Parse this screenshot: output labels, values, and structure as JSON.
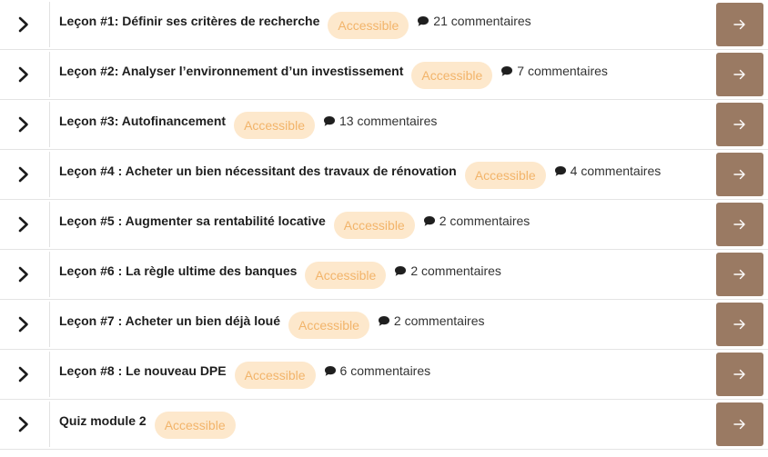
{
  "lessons": [
    {
      "title": "Leçon #1: Définir ses critères de recherche",
      "status": "Accessible",
      "comments": "21 commentaires"
    },
    {
      "title": "Leçon #2: Analyser l’environnement d’un investissement",
      "status": "Accessible",
      "comments": "7 commentaires"
    },
    {
      "title": "Leçon #3: Autofinancement",
      "status": "Accessible",
      "comments": "13 commentaires"
    },
    {
      "title": "Leçon #4 : Acheter un bien nécessitant des travaux de rénovation",
      "status": "Accessible",
      "comments": "4 commentaires"
    },
    {
      "title": "Leçon #5 : Augmenter sa rentabilité locative",
      "status": "Accessible",
      "comments": "2 commentaires"
    },
    {
      "title": "Leçon #6 : La règle ultime des banques",
      "status": "Accessible",
      "comments": "2 commentaires"
    },
    {
      "title": "Leçon #7 : Acheter un bien déjà loué",
      "status": "Accessible",
      "comments": "2 commentaires"
    },
    {
      "title": "Leçon #8 : Le nouveau DPE",
      "status": "Accessible",
      "comments": "6 commentaires"
    },
    {
      "title": "Quiz module 2",
      "status": "Accessible"
    }
  ],
  "icons": {
    "expand": "chevron-right-icon",
    "comment": "comment-bubble-icon",
    "go": "arrow-right-icon"
  },
  "colors": {
    "badge_bg": "#fde8cc",
    "badge_text": "#f2b46a",
    "go_button_bg": "#9a7a63"
  }
}
